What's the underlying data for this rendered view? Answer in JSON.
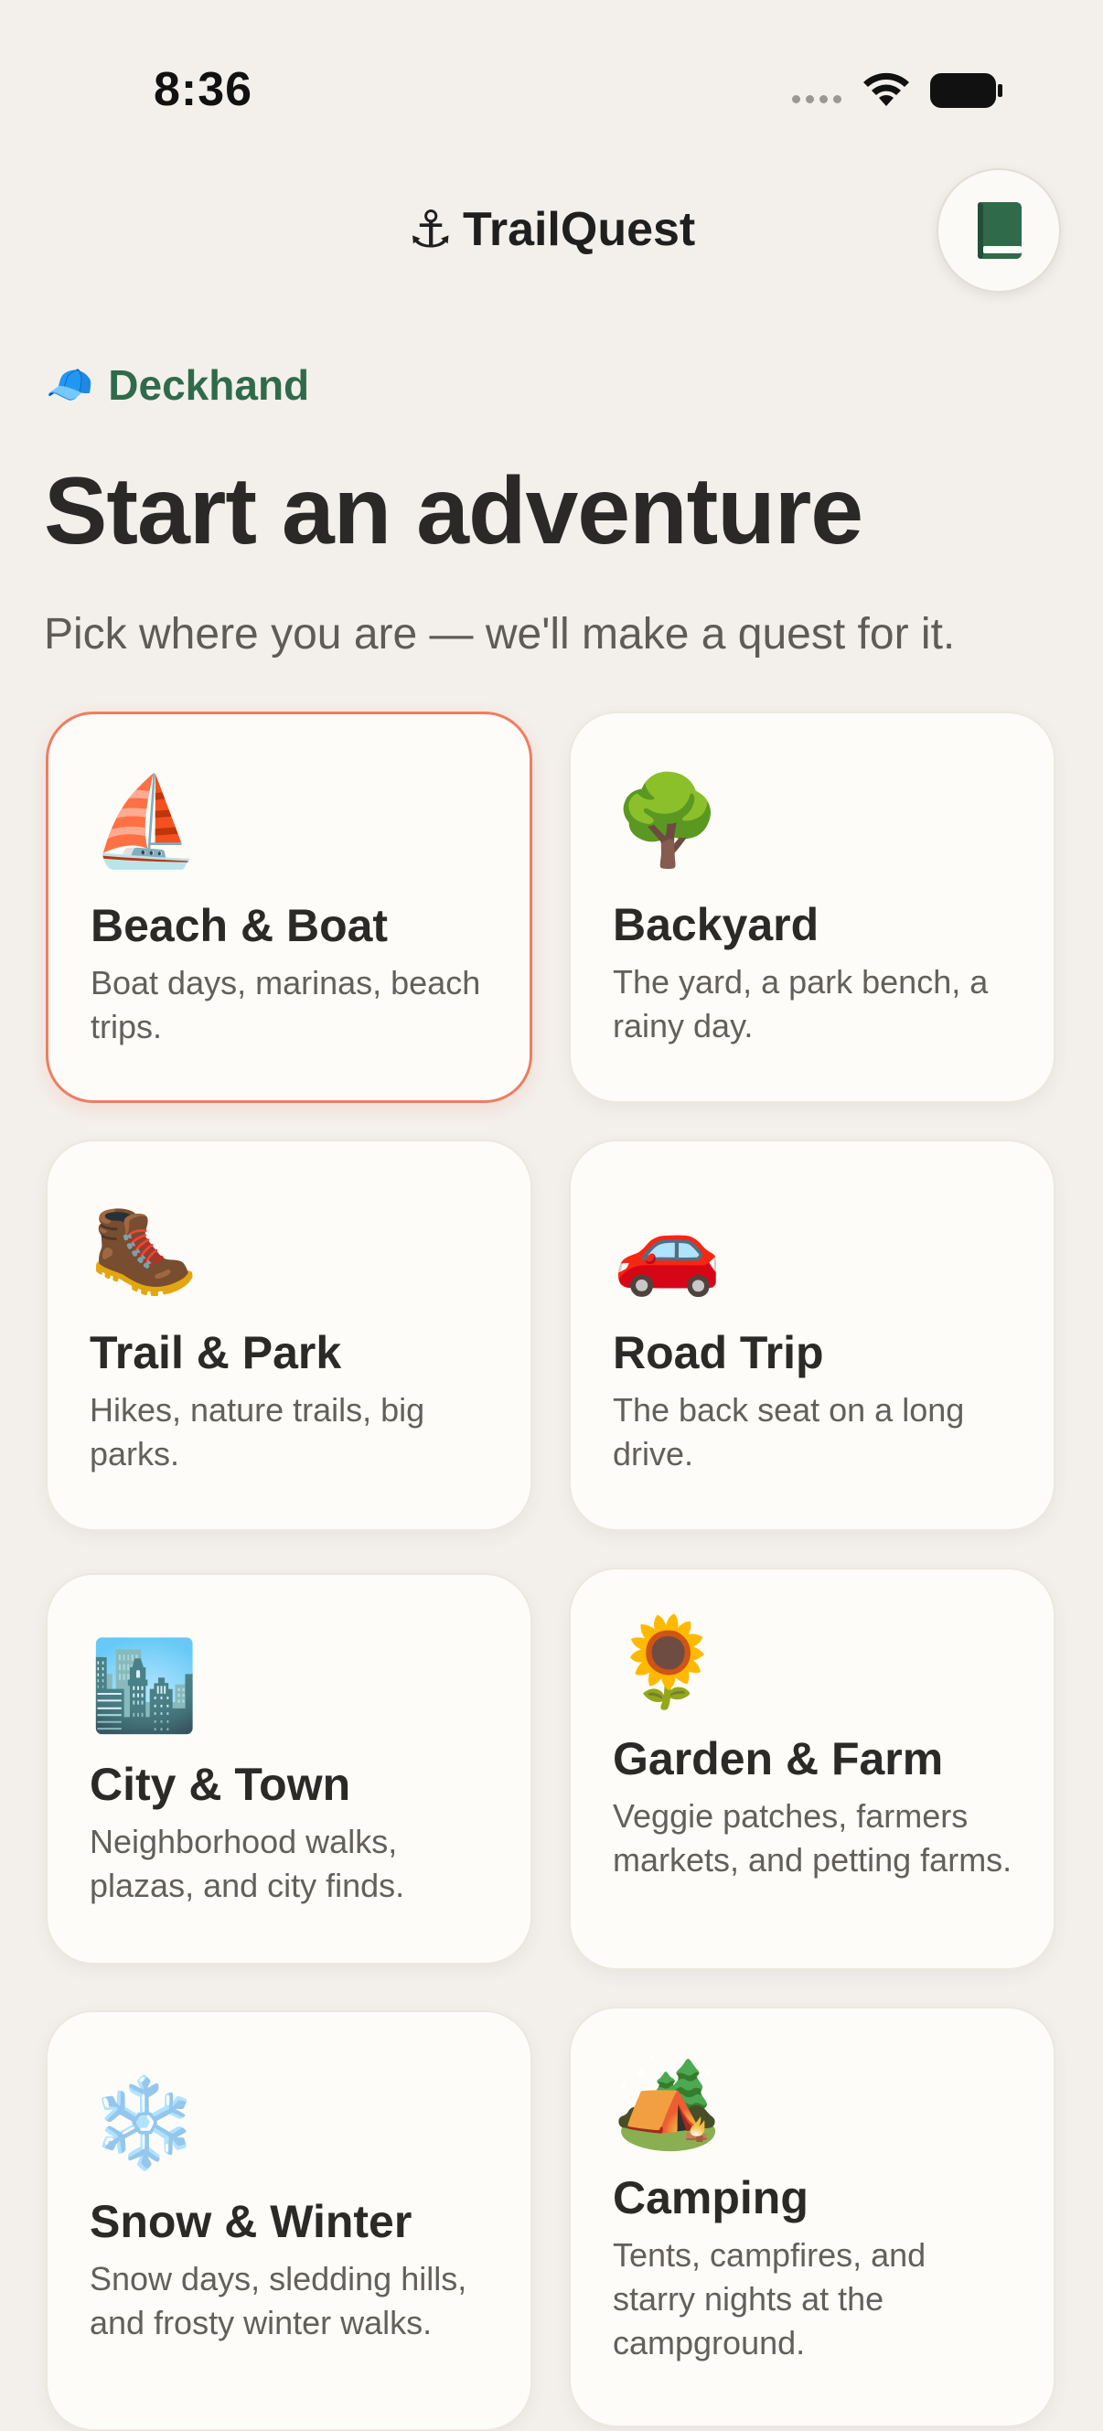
{
  "status": {
    "time": "8:36"
  },
  "header": {
    "anchor_emoji": "⚓",
    "app_title": "TrailQuest"
  },
  "rank": {
    "emoji": "🧢",
    "label": "Deckhand"
  },
  "hero": {
    "title": "Start an adventure",
    "subtitle": "Pick where you are — we'll make a quest for it."
  },
  "cards": [
    {
      "emoji": "⛵",
      "title": "Beach & Boat",
      "desc": "Boat days, marinas, beach trips.",
      "selected": true
    },
    {
      "emoji": "🌳",
      "title": "Backyard",
      "desc": "The yard, a park bench, a rainy day."
    },
    {
      "emoji": "🥾",
      "title": "Trail & Park",
      "desc": "Hikes, nature trails, big parks."
    },
    {
      "emoji": "🚗",
      "title": "Road Trip",
      "desc": "The back seat on a long drive."
    },
    {
      "emoji": "🏙️",
      "title": "City & Town",
      "desc": "Neighborhood walks, plazas, and city finds."
    },
    {
      "emoji": "🌻",
      "title": "Garden & Farm",
      "desc": "Veggie patches, farmers markets, and petting farms."
    },
    {
      "emoji": "❄️",
      "title": "Snow & Winter",
      "desc": "Snow days, sledding hills, and frosty winter walks."
    },
    {
      "emoji": "🏕️",
      "title": "Camping",
      "desc": "Tents, campfires, and starry nights at the campground."
    }
  ],
  "colors": {
    "accent_green": "#2f6b4a",
    "selected_border": "#ec7e63",
    "background": "#f3f0eb"
  },
  "icons": {
    "book_button": "book-icon"
  }
}
